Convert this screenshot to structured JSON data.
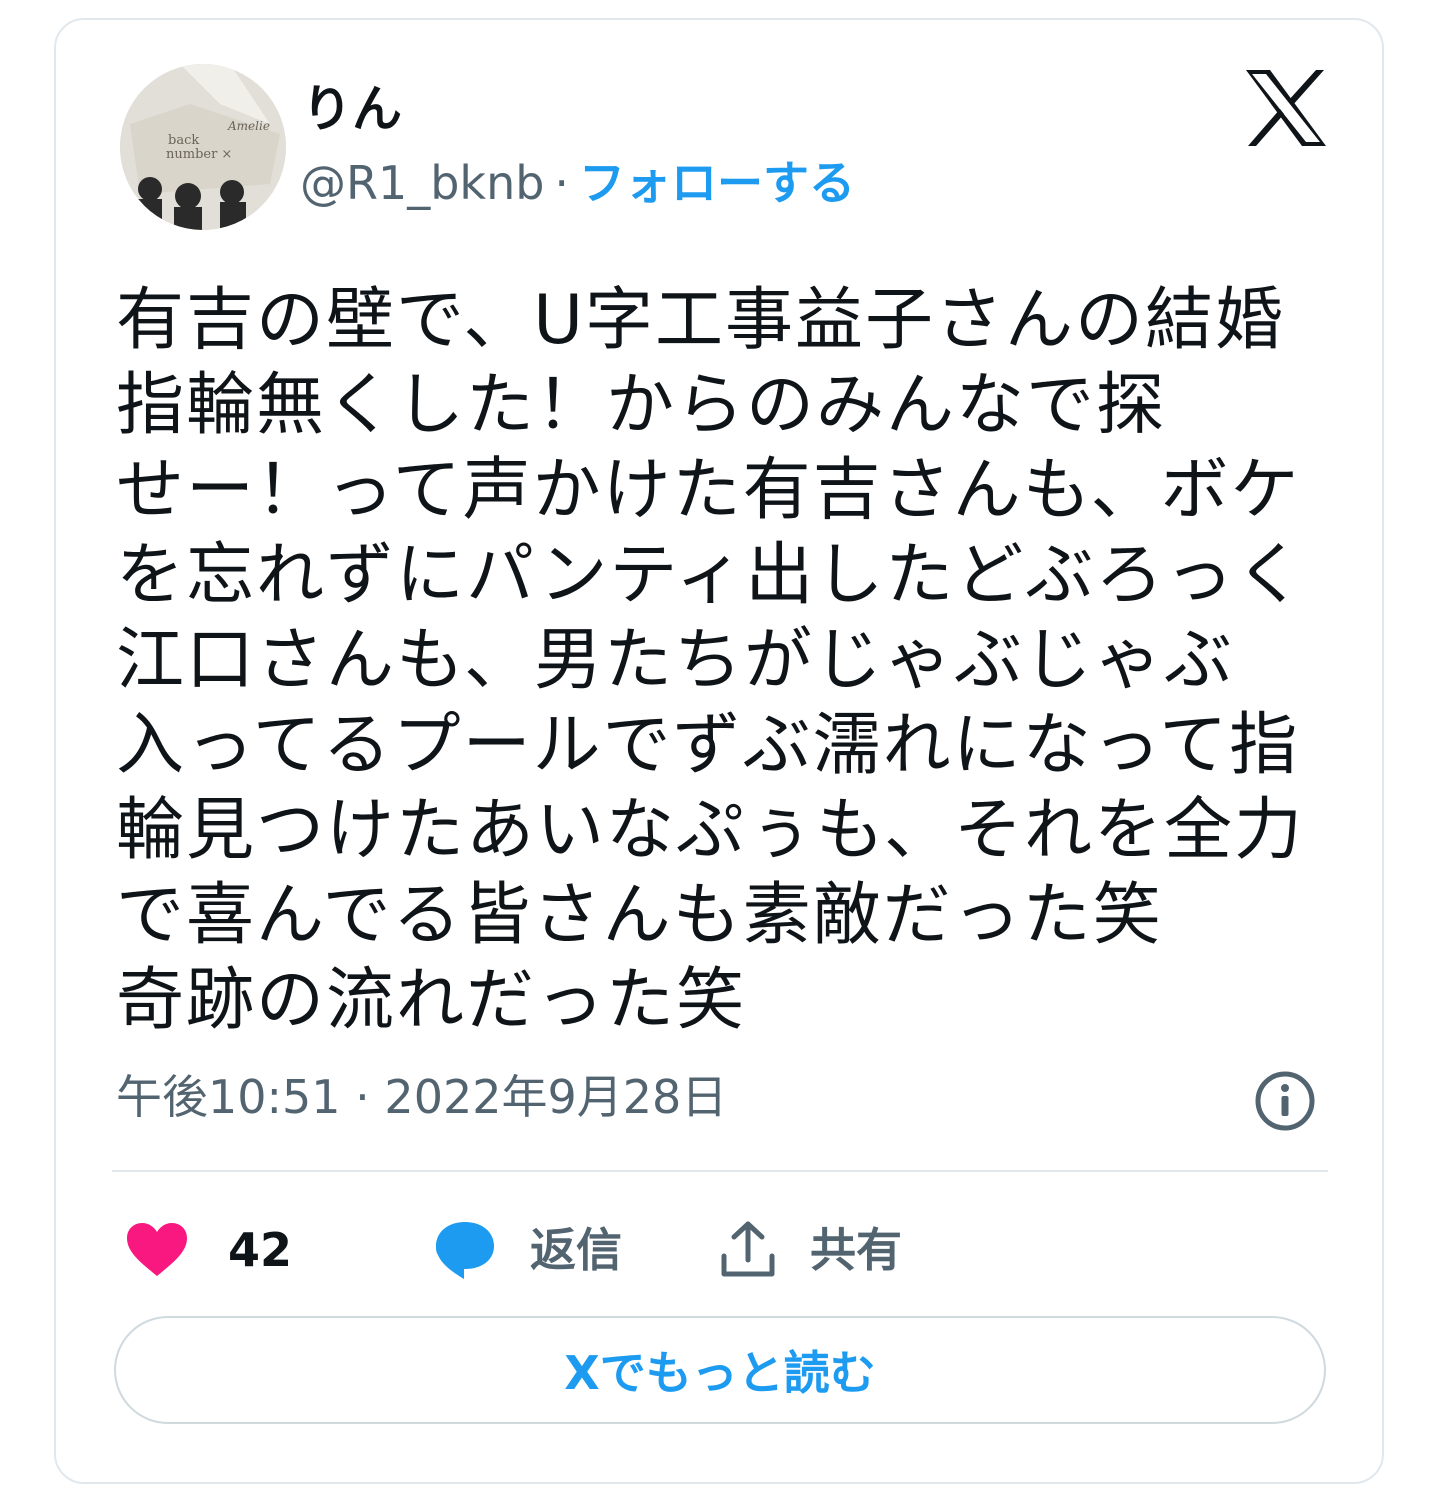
{
  "user": {
    "display_name": "りん",
    "handle": "@R1_bknb",
    "separator": "·",
    "follow_label": "フォローする"
  },
  "tweet": {
    "text": "有吉の壁で、U字工事益子さんの結婚\n指輪無くした！からのみんなで探\nせー！って声かけた有吉さんも、ボケ\nを忘れずにパンティ出したどぶろっく\n江口さんも、男たちがじゃぶじゃぶ\n入ってるプールでずぶ濡れになって指\n輪見つけたあいなぷぅも、それを全力\nで喜んでる皆さんも素敵だった笑\n奇跡の流れだった笑",
    "timestamp": "午後10:51 · 2022年9月28日"
  },
  "actions": {
    "like_count": "42",
    "reply_label": "返信",
    "share_label": "共有"
  },
  "read_more_label": "Xでもっと読む",
  "colors": {
    "accent": "#1d9bf0",
    "like": "#f91880",
    "secondary_text": "#536471",
    "border": "#e1e8ed"
  },
  "icons": {
    "brand": "x-logo-icon",
    "info": "info-icon",
    "like": "heart-icon",
    "reply": "speech-bubble-icon",
    "share": "share-upload-icon"
  }
}
